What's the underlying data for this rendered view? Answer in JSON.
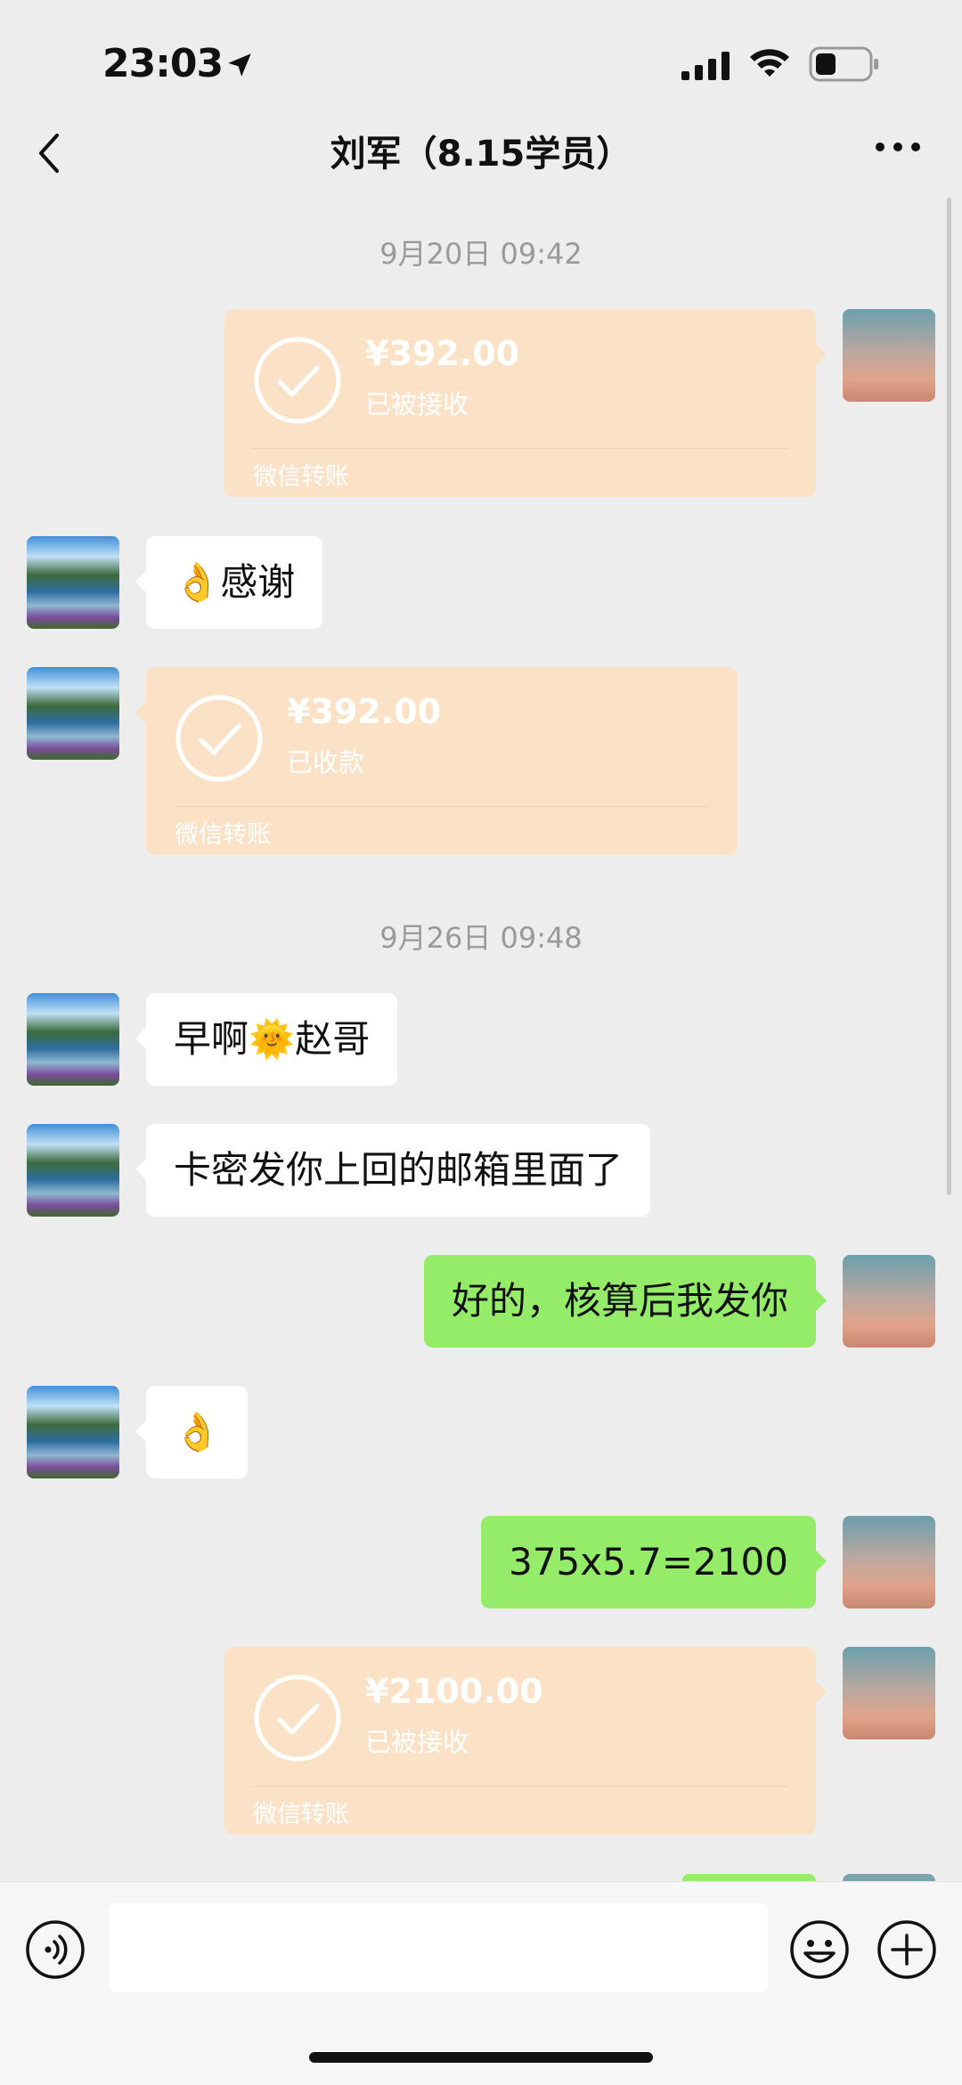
{
  "status_bar": {
    "time": "23:03"
  },
  "header": {
    "title": "刘军（8.15学员）"
  },
  "timestamps": [
    "9月20日 09:42",
    "9月26日 09:48"
  ],
  "messages": [
    {
      "type": "transfer",
      "side": "right",
      "amount": "¥392.00",
      "status": "已被接收",
      "label": "微信转账"
    },
    {
      "type": "text",
      "side": "left",
      "text": "👌感谢"
    },
    {
      "type": "transfer",
      "side": "left",
      "amount": "¥392.00",
      "status": "已收款",
      "label": "微信转账"
    },
    {
      "type": "text",
      "side": "left",
      "text": "早啊🌞赵哥"
    },
    {
      "type": "text",
      "side": "left",
      "text": "卡密发你上回的邮箱里面了"
    },
    {
      "type": "text",
      "side": "right",
      "text": "好的，核算后我发你"
    },
    {
      "type": "text",
      "side": "left",
      "text": "👌"
    },
    {
      "type": "text",
      "side": "right",
      "text": "375x5.7=2100"
    },
    {
      "type": "transfer",
      "side": "right",
      "amount": "¥2100.00",
      "status": "已被接收",
      "label": "微信转账"
    }
  ],
  "input": {
    "value": ""
  },
  "colors": {
    "background": "#ededed",
    "bubble_green": "#95ec69",
    "bubble_white": "#ffffff",
    "transfer": "#fbe2c6"
  },
  "icons": [
    "location-arrow-icon",
    "signal-icon",
    "wifi-icon",
    "battery-icon",
    "back-chevron-icon",
    "more-dots-icon",
    "check-circle-icon",
    "voice-icon",
    "emoji-icon",
    "plus-icon"
  ]
}
